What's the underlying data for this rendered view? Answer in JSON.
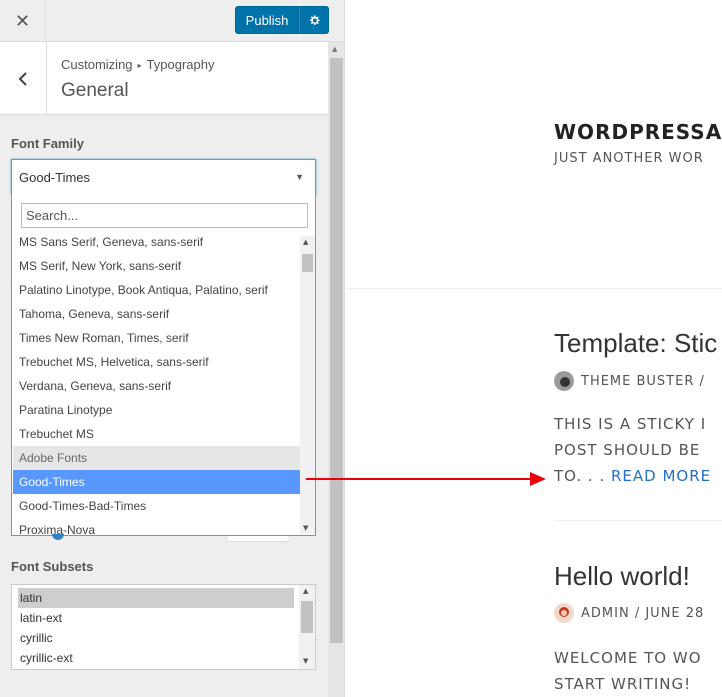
{
  "topbar": {
    "close_glyph": "✕",
    "publish_label": "Publish",
    "settings_icon": "gear-icon"
  },
  "section": {
    "breadcrumb_parent": "Customizing",
    "breadcrumb_child": "Typography",
    "title": "General"
  },
  "font_family": {
    "label": "Font Family",
    "selected_value": "Good-Times",
    "search_placeholder": "Search...",
    "options": [
      {
        "label": "MS Sans Serif, Geneva, sans-serif",
        "type": "option"
      },
      {
        "label": "MS Serif, New York, sans-serif",
        "type": "option"
      },
      {
        "label": "Palatino Linotype, Book Antiqua, Palatino, serif",
        "type": "option"
      },
      {
        "label": "Tahoma, Geneva, sans-serif",
        "type": "option"
      },
      {
        "label": "Times New Roman, Times, serif",
        "type": "option"
      },
      {
        "label": "Trebuchet MS, Helvetica, sans-serif",
        "type": "option"
      },
      {
        "label": "Verdana, Geneva, sans-serif",
        "type": "option"
      },
      {
        "label": "Paratina Linotype",
        "type": "option"
      },
      {
        "label": "Trebuchet MS",
        "type": "option"
      },
      {
        "label": "Adobe Fonts",
        "type": "group"
      },
      {
        "label": "Good-Times",
        "type": "selected"
      },
      {
        "label": "Good-Times-Bad-Times",
        "type": "option"
      },
      {
        "label": "Proxima-Nova",
        "type": "option"
      }
    ]
  },
  "font_subsets": {
    "label": "Font Subsets",
    "options": [
      {
        "label": "latin",
        "selected": true
      },
      {
        "label": "latin-ext",
        "selected": false
      },
      {
        "label": "cyrillic",
        "selected": false
      },
      {
        "label": "cyrillic-ext",
        "selected": false
      }
    ]
  },
  "preview": {
    "site_title": "WORDPRESSA",
    "site_tagline": "JUST ANOTHER WOR",
    "posts": [
      {
        "title": "Template: Stic",
        "author": "THEME BUSTER",
        "meta_suffix": "/",
        "excerpt_lines": [
          "THIS IS A STICKY I",
          "POST SHOULD BE",
          "TO. . ."
        ],
        "read_more": "READ MORE"
      },
      {
        "title": "Hello world!",
        "author": "ADMIN",
        "meta_suffix": "/ JUNE 28",
        "excerpt_lines": [
          "WELCOME TO WO",
          "START WRITING!"
        ]
      }
    ]
  },
  "colors": {
    "publish": "#0073aa",
    "highlight": "#5897fb",
    "arrow": "#e8000b",
    "link": "#2370c4"
  }
}
